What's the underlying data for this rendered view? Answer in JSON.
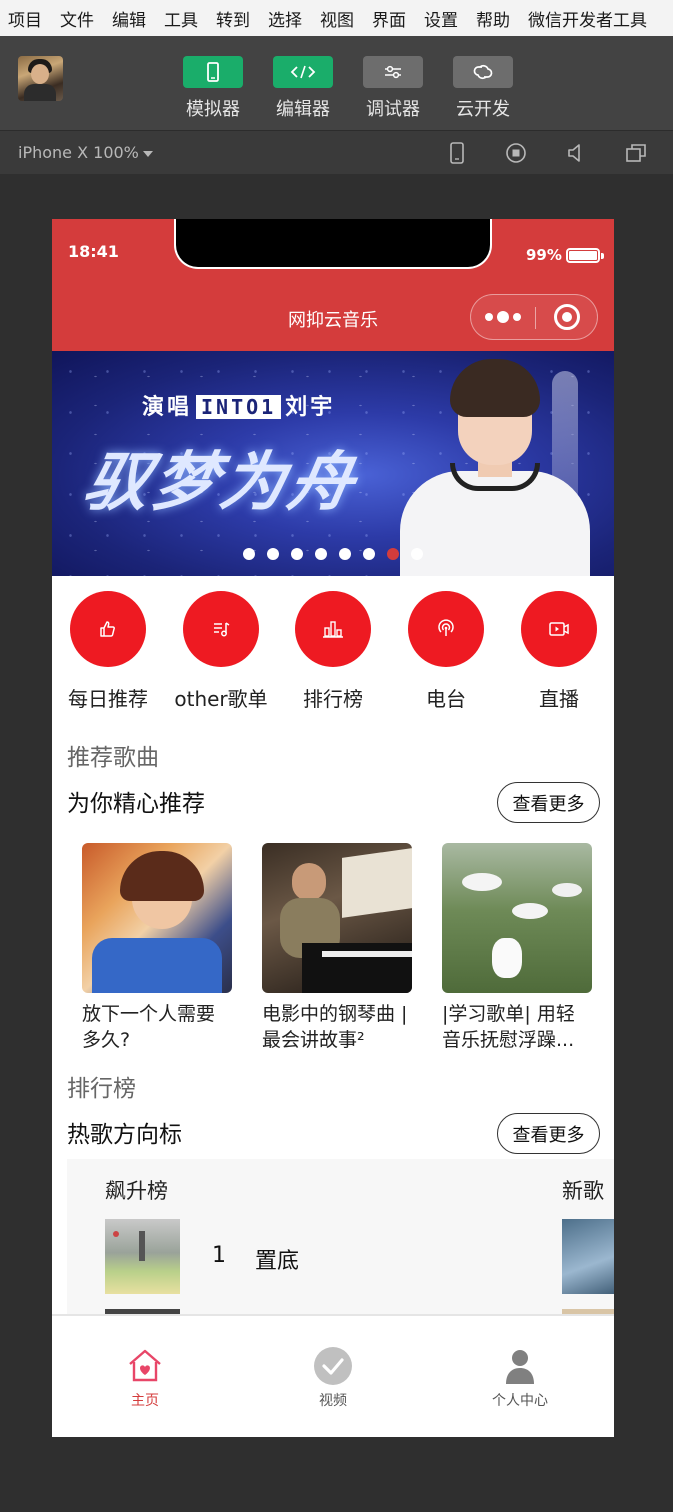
{
  "menubar": {
    "items": [
      "项目",
      "文件",
      "编辑",
      "工具",
      "转到",
      "选择",
      "视图",
      "界面",
      "设置",
      "帮助",
      "微信开发者工具"
    ]
  },
  "toolbar": {
    "buttons": [
      {
        "label": "模拟器",
        "icon": "phone-icon",
        "color": "#1aad6a"
      },
      {
        "label": "编辑器",
        "icon": "code-icon",
        "color": "#1aad6a"
      },
      {
        "label": "调试器",
        "icon": "sliders-icon",
        "color": "#6d6d6d"
      },
      {
        "label": "云开发",
        "icon": "cloud-icon",
        "color": "#6d6d6d"
      }
    ]
  },
  "device": {
    "selector": "iPhone X 100%"
  },
  "phone": {
    "status": {
      "time": "18:41",
      "battery": "99%"
    },
    "nav_title": "网抑云音乐",
    "banner": {
      "subtitle_pre": "演唱",
      "subtitle_box": "INTO1",
      "subtitle_post": "刘宇",
      "title": "驭梦为舟",
      "dots": 8,
      "active_dot": 6
    },
    "nav_items": [
      {
        "label": "每日推荐",
        "icon": "thumbs-up-icon"
      },
      {
        "label": "other歌单",
        "icon": "playlist-icon"
      },
      {
        "label": "排行榜",
        "icon": "bar-chart-icon"
      },
      {
        "label": "电台",
        "icon": "radio-icon"
      },
      {
        "label": "直播",
        "icon": "live-icon"
      }
    ],
    "recommend": {
      "title": "推荐歌曲",
      "subtitle": "为你精心推荐",
      "more": "查看更多",
      "items": [
        {
          "name": "放下一个人需要多久?"
        },
        {
          "name": "电影中的钢琴曲 | 最会讲故事²"
        },
        {
          "name": "|学习歌单| 用轻音乐抚慰浮躁..."
        }
      ]
    },
    "ranking": {
      "title": "排行榜",
      "subtitle": "热歌方向标",
      "more": "查看更多",
      "cards": [
        {
          "title": "飙升榜",
          "songs": [
            {
              "rank": "1",
              "name": "置底"
            }
          ]
        },
        {
          "title": "新歌"
        }
      ]
    },
    "tabbar": [
      {
        "label": "主页",
        "icon": "home-heart-icon",
        "active": true
      },
      {
        "label": "视频",
        "icon": "check-circle-icon",
        "active": false
      },
      {
        "label": "个人中心",
        "icon": "person-icon",
        "active": false
      }
    ],
    "colors": {
      "brand": "#d43c3c",
      "accent": "#ee1a22"
    }
  }
}
